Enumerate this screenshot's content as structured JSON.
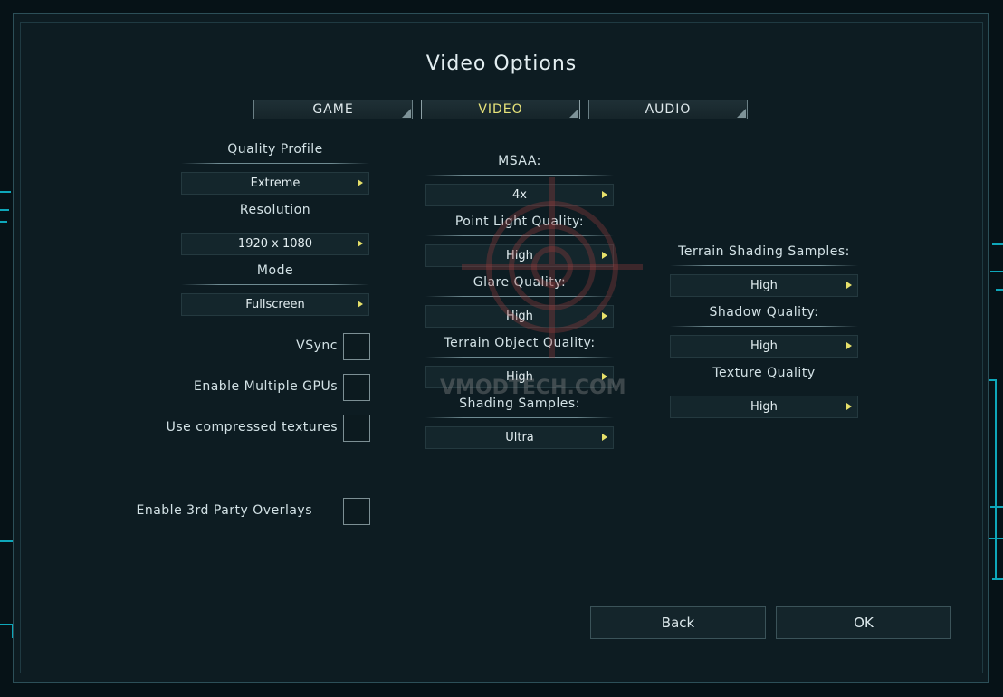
{
  "title": "Video Options",
  "tabs": [
    {
      "label": "GAME",
      "active": false
    },
    {
      "label": "VIDEO",
      "active": true
    },
    {
      "label": "AUDIO",
      "active": false
    }
  ],
  "left": {
    "quality_profile": {
      "label": "Quality Profile",
      "value": "Extreme"
    },
    "resolution": {
      "label": "Resolution",
      "value": "1920 x 1080"
    },
    "mode": {
      "label": "Mode",
      "value": "Fullscreen"
    },
    "checkboxes": {
      "vsync": {
        "label": "VSync",
        "checked": false
      },
      "multi_gpu": {
        "label": "Enable Multiple GPUs",
        "checked": false
      },
      "compressed": {
        "label": "Use compressed textures",
        "checked": false
      },
      "overlays": {
        "label": "Enable 3rd Party Overlays",
        "checked": false
      }
    }
  },
  "middle": {
    "msaa": {
      "label": "MSAA:",
      "value": "4x"
    },
    "point_light": {
      "label": "Point Light Quality:",
      "value": "High"
    },
    "glare": {
      "label": "Glare Quality:",
      "value": "High"
    },
    "terrain_object": {
      "label": "Terrain Object Quality:",
      "value": "High"
    },
    "shading_samples": {
      "label": "Shading Samples:",
      "value": "Ultra"
    }
  },
  "right": {
    "terrain_shading": {
      "label": "Terrain Shading Samples:",
      "value": "High"
    },
    "shadow": {
      "label": "Shadow Quality:",
      "value": "High"
    },
    "texture": {
      "label": "Texture Quality",
      "value": "High"
    }
  },
  "buttons": {
    "back": "Back",
    "ok": "OK"
  },
  "watermark": "VMODTECH.COM",
  "colors": {
    "accent_arrow": "#e6e06a",
    "active_tab": "#e8e47a",
    "glow": "#12c6d8"
  }
}
